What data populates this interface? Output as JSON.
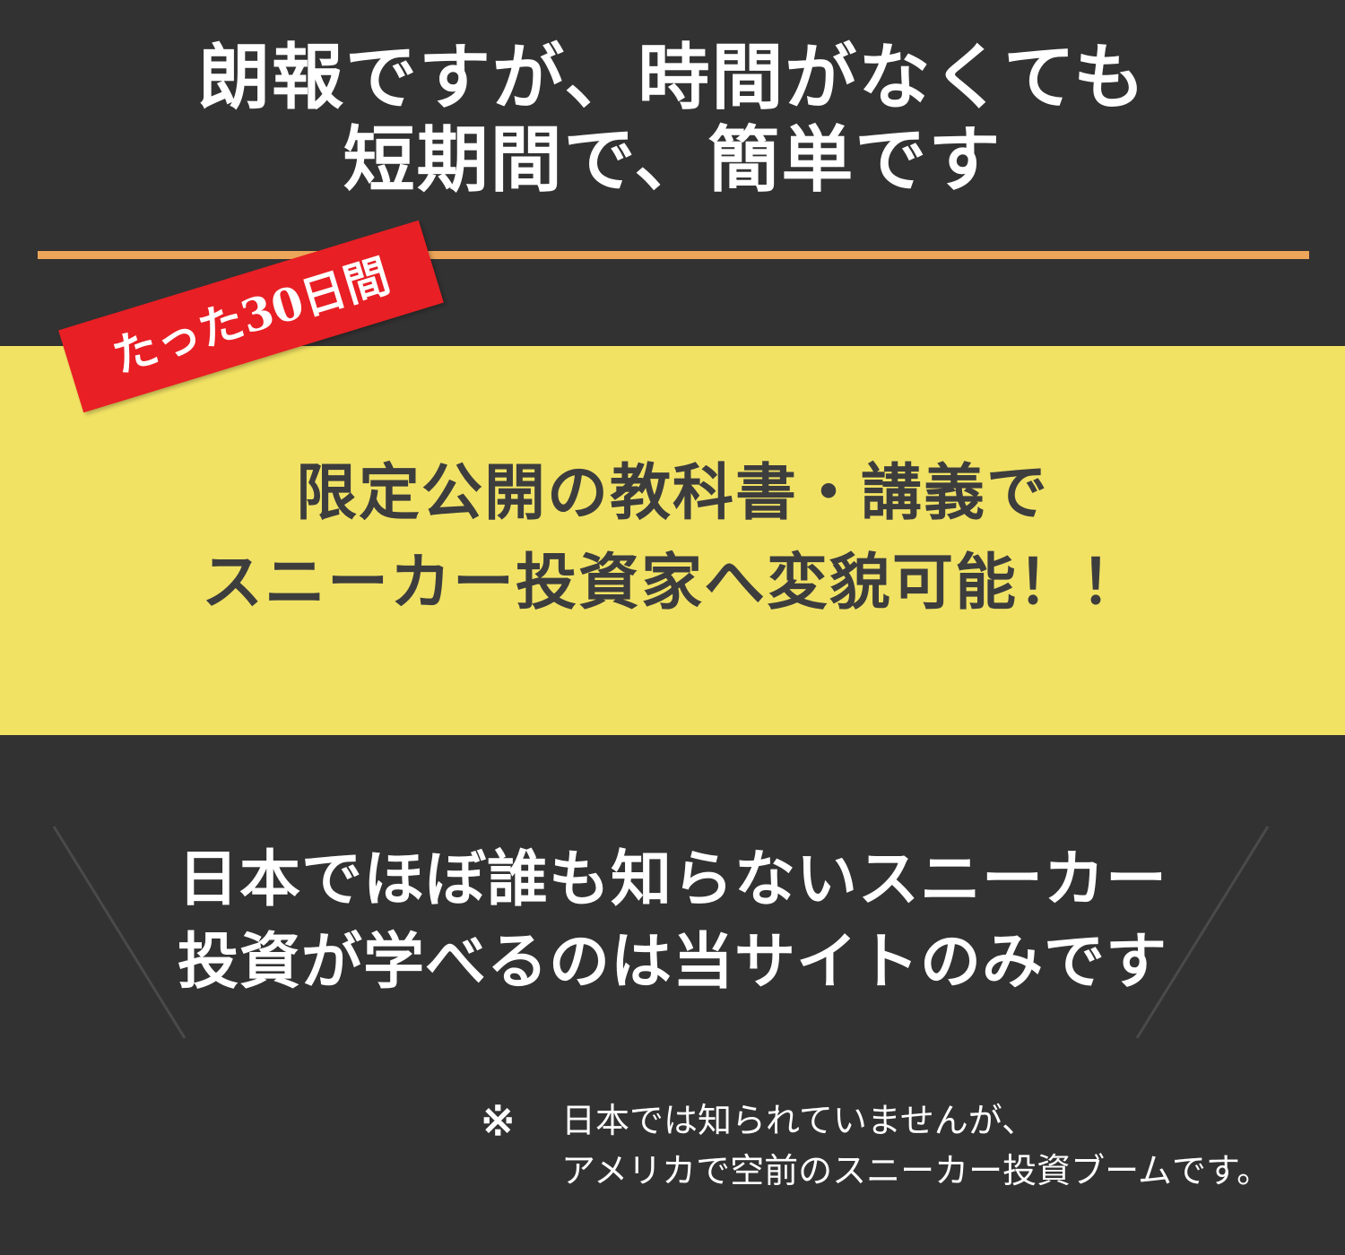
{
  "headline": {
    "line1": "朗報ですが、時間がなくても",
    "line2": "短期間で、簡単です"
  },
  "badge": {
    "label": "たった30日間"
  },
  "panel": {
    "line1": "限定公開の教科書・講義で",
    "line2": "スニーカー投資家へ変貌可能！！"
  },
  "claim": {
    "line1": "日本でほぼ誰も知らないスニーカー",
    "line2": "投資が学べるのは当サイトのみです"
  },
  "note": {
    "mark": "※",
    "line1": "日本では知られていませんが、",
    "line2": "アメリカで空前のスニーカー投資ブームです。"
  },
  "colors": {
    "background": "#333232",
    "divider": "#eda659",
    "panel": "#f1e264",
    "badge": "#e81f24",
    "panel_text": "#3d3d3d"
  }
}
